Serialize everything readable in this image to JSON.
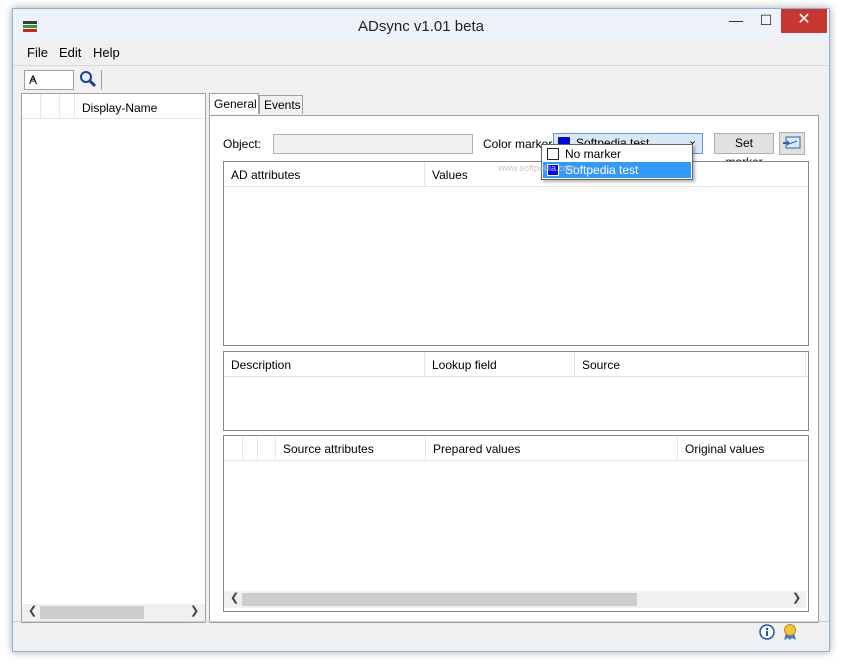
{
  "window": {
    "title": "ADsync v1.01 beta",
    "min_icon": "minimize-icon",
    "max_icon": "maximize-icon",
    "close_icon": "close-icon"
  },
  "menu": {
    "file": "File",
    "edit": "Edit",
    "help": "Help"
  },
  "toolbar": {
    "letter_value": "A",
    "search_icon": "magnifier-icon"
  },
  "left_panel": {
    "column": "Display-Name"
  },
  "tabs": {
    "general": "General",
    "events": "Events"
  },
  "general": {
    "object_label": "Object:",
    "object_value": "",
    "color_marker_label": "Color marker:",
    "color_marker_value": "Softpedia test",
    "set_marker": "Set marker",
    "dropdown": [
      {
        "label": "No marker",
        "color": "#ffffff",
        "selected": false
      },
      {
        "label": "Softpedia test",
        "color": "#0000ff",
        "selected": true
      }
    ],
    "grid1": {
      "col1": "AD attributes",
      "col2": "Values"
    },
    "grid2": {
      "col1": "Description",
      "col2": "Lookup field",
      "col3": "Source"
    },
    "grid3": {
      "col1": "Source attributes",
      "col2": "Prepared values",
      "col3": "Original values"
    }
  },
  "watermark": "www.softpedia.com",
  "colors": {
    "accent": "#3399ff",
    "marker_blue": "#0000ff",
    "close": "#c7372f"
  }
}
